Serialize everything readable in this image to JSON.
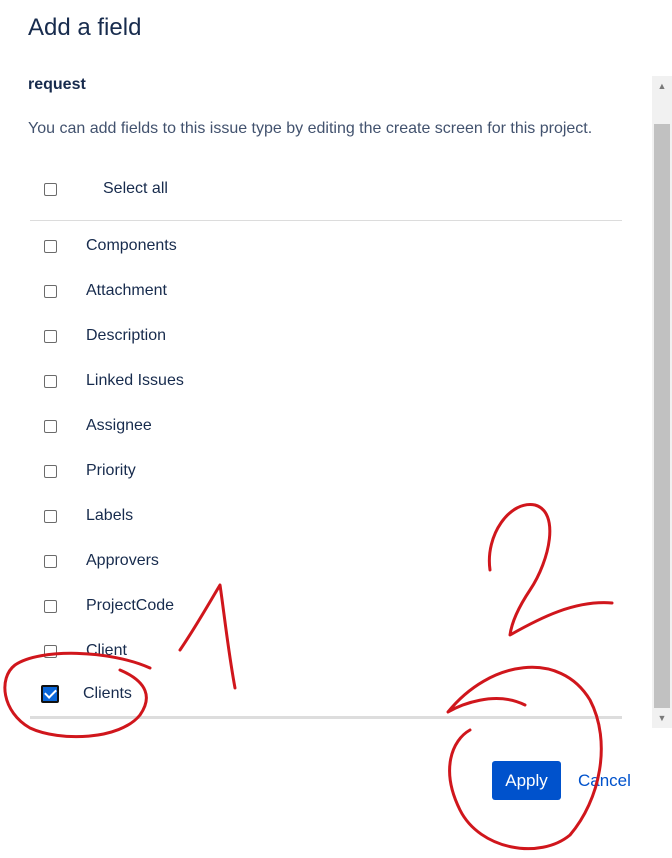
{
  "dialog": {
    "title": "Add a field",
    "issue_type": "request",
    "description": "You can add fields to this issue type by editing the create screen for this project.",
    "select_all_label": "Select all",
    "select_all_checked": false
  },
  "fields": [
    {
      "label": "Components",
      "checked": false
    },
    {
      "label": "Attachment",
      "checked": false
    },
    {
      "label": "Description",
      "checked": false
    },
    {
      "label": "Linked Issues",
      "checked": false
    },
    {
      "label": "Assignee",
      "checked": false
    },
    {
      "label": "Priority",
      "checked": false
    },
    {
      "label": "Labels",
      "checked": false
    },
    {
      "label": "Approvers",
      "checked": false
    },
    {
      "label": "ProjectCode",
      "checked": false
    },
    {
      "label": "Client",
      "checked": false
    },
    {
      "label": "Clients",
      "checked": true
    }
  ],
  "actions": {
    "apply_label": "Apply",
    "cancel_label": "Cancel"
  },
  "scrollbar": {
    "up_icon": "triangle-up",
    "down_icon": "triangle-down"
  },
  "annotation_color": "#d0161c",
  "primary_color": "#0052cc"
}
